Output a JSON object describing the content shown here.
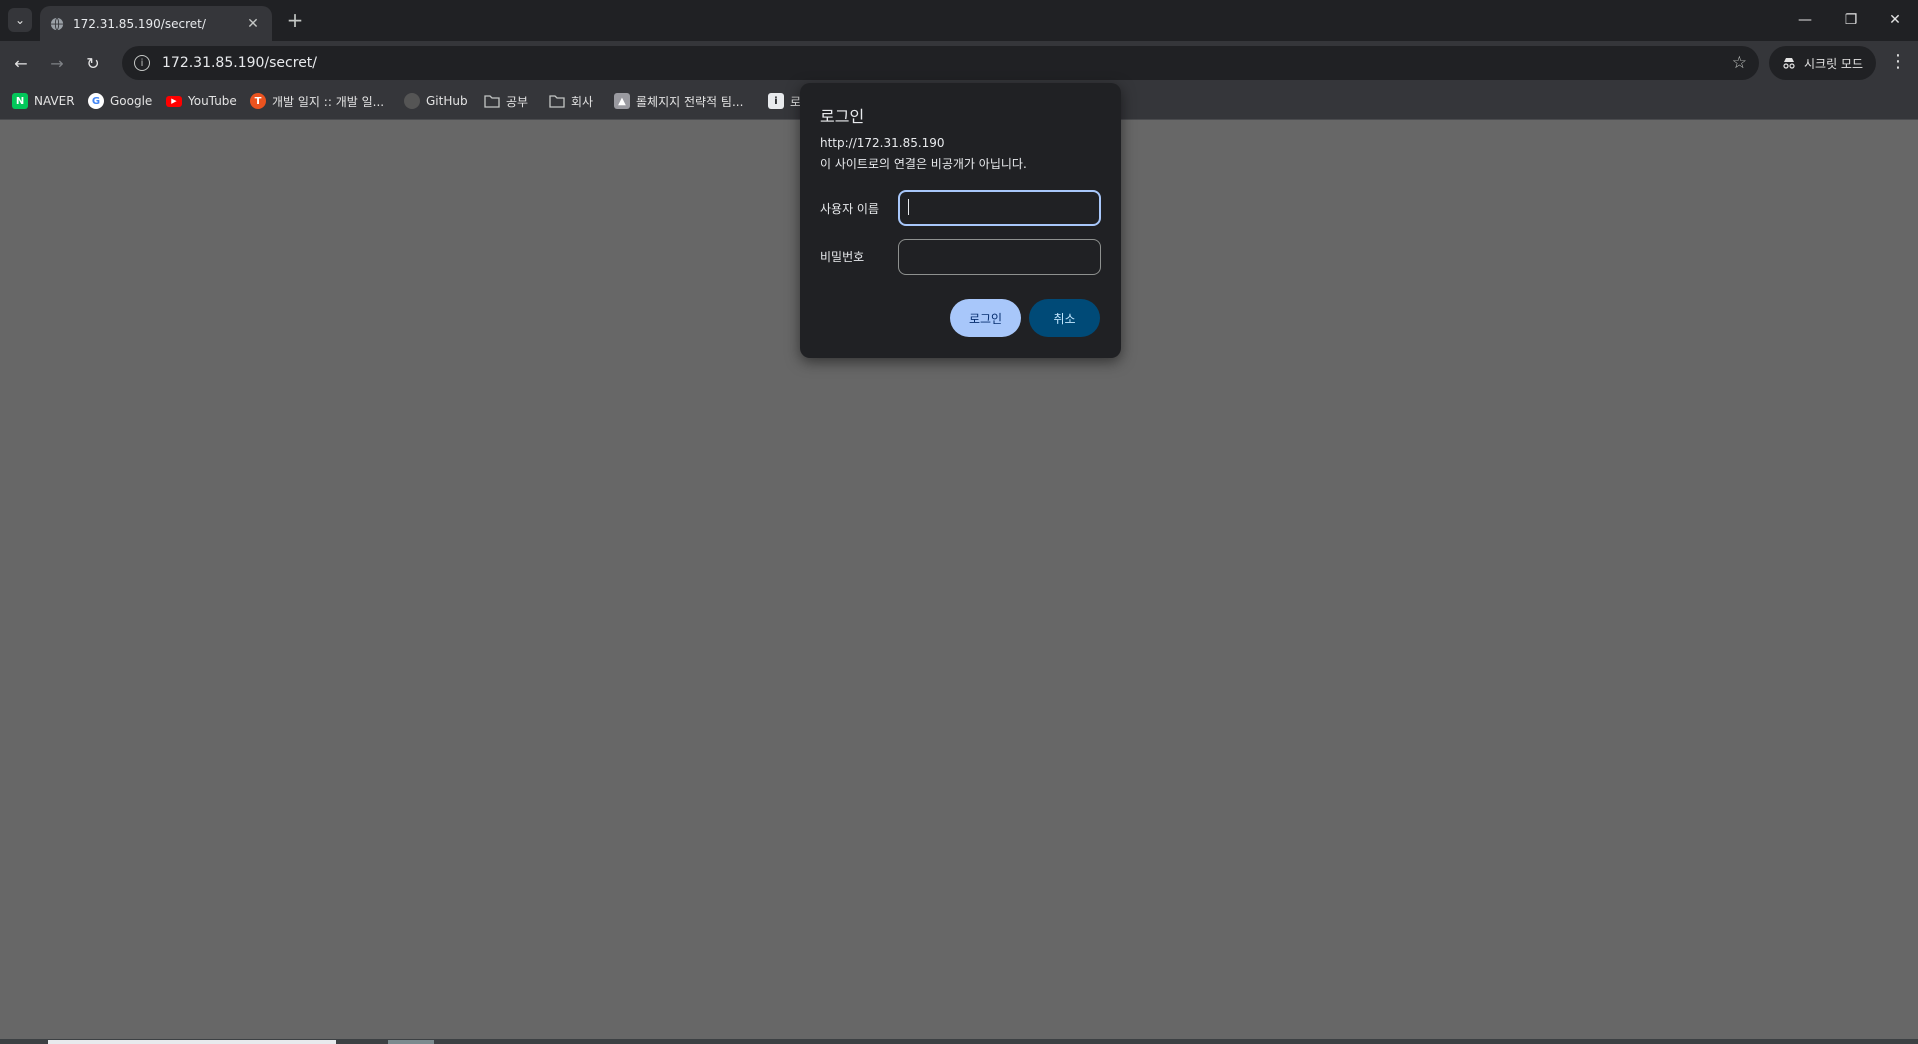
{
  "browser": {
    "tab": {
      "title": "172.31.85.190/secret/"
    },
    "url": "172.31.85.190/secret/",
    "incognito_label": "시크릿 모드"
  },
  "bookmarks": [
    {
      "label": "NAVER",
      "icon": "naver-icon",
      "color": "#03c75a"
    },
    {
      "label": "Google",
      "icon": "google-icon",
      "color": "#4285f4"
    },
    {
      "label": "YouTube",
      "icon": "youtube-icon",
      "color": "#ff0000"
    },
    {
      "label": "개발 일지 :: 개발 일...",
      "icon": "tistory-icon",
      "color": "#eb531f"
    },
    {
      "label": "GitHub",
      "icon": "github-icon",
      "color": "#555555"
    },
    {
      "label": "공부",
      "icon": "folder-icon",
      "color": "#c4c7c5"
    },
    {
      "label": "회사",
      "icon": "folder-icon",
      "color": "#c4c7c5"
    },
    {
      "label": "롤체지지 전략적 팀...",
      "icon": "lolchess-icon",
      "color": "#9a9aa0"
    },
    {
      "label": "로",
      "icon": "bookmark-icon",
      "color": "#e8eaed"
    }
  ],
  "dialog": {
    "title": "로그인",
    "origin": "http://172.31.85.190",
    "warning": "이 사이트로의 연결은 비공개가 아닙니다.",
    "username_label": "사용자 이름",
    "username_value": "",
    "password_label": "비밀번호",
    "password_value": "",
    "login_button": "로그인",
    "cancel_button": "취소"
  },
  "colors": {
    "page_background": "#676767",
    "dialog_background": "#202124",
    "primary_button": "#a8c7fa",
    "secondary_button": "#004a77"
  }
}
